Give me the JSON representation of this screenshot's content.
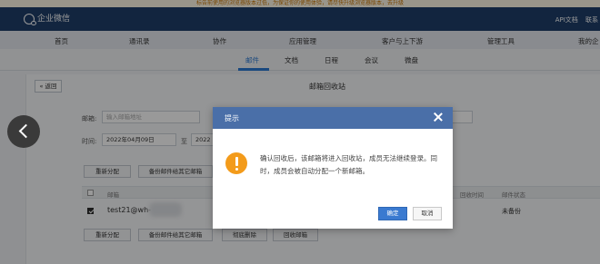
{
  "notice": "标告前使用的浏览器版本过低，为保证你的使用体验，请尽快升级浏览器版本，去升级",
  "app": {
    "name": "企业微信"
  },
  "topbar": {
    "links": [
      "API文档",
      "联系"
    ]
  },
  "main_nav": [
    "首页",
    "通讯录",
    "协作",
    "应用管理",
    "客户与上下游",
    "管理工具",
    "我的企"
  ],
  "sub_nav": {
    "items": [
      "邮件",
      "文档",
      "日程",
      "会议",
      "微盘"
    ],
    "active_index": 0
  },
  "page": {
    "back_label": "« 返回",
    "title": "邮箱回收站"
  },
  "filters": {
    "mailbox_label": "邮箱:",
    "mailbox_placeholder": "输入邮箱地址",
    "time_label": "时间:",
    "date_from": "2022年04月09日",
    "date_sep": "至",
    "date_to": "2022"
  },
  "toolbar_top": [
    "重新分配",
    "备份邮件给其它邮箱"
  ],
  "table": {
    "col_email": "邮箱",
    "col_time": "回收时间",
    "col_status": "邮件状态",
    "rows": [
      {
        "email": "test21@wh-",
        "status": "未备份",
        "checked": true
      }
    ]
  },
  "toolbar_bottom": [
    "重新分配",
    "备份邮件给其它邮箱",
    "彻底删除",
    "回收邮箱"
  ],
  "dialog": {
    "title": "提示",
    "message": "确认回收后，该邮箱将进入回收站，成员无法继续登录。同时，成员会被自动分配一个新邮箱。",
    "ok_label": "确定",
    "cancel_label": "取消"
  },
  "colors": {
    "topbar": "#1f3f6a",
    "dialog_header": "#4a6fa8",
    "primary": "#3a7ad0",
    "warning": "#f39b1b"
  }
}
